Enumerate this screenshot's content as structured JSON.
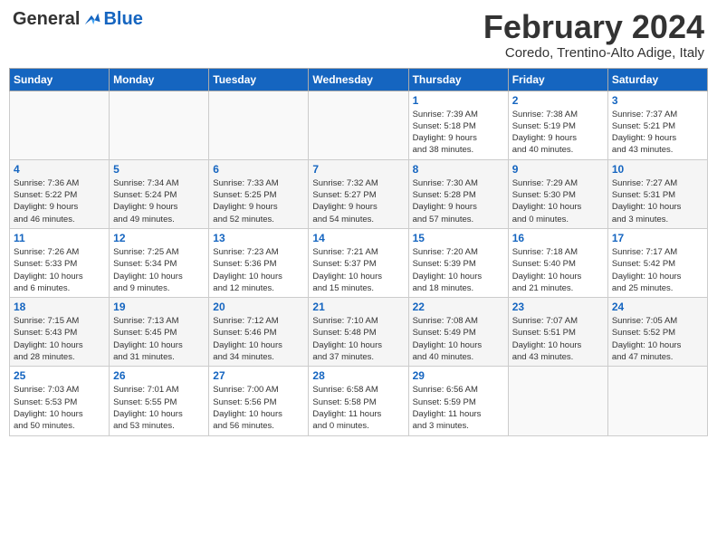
{
  "header": {
    "logo": {
      "general": "General",
      "blue": "Blue"
    },
    "title": "February 2024",
    "location": "Coredo, Trentino-Alto Adige, Italy"
  },
  "weekdays": [
    "Sunday",
    "Monday",
    "Tuesday",
    "Wednesday",
    "Thursday",
    "Friday",
    "Saturday"
  ],
  "weeks": [
    [
      {
        "day": "",
        "info": ""
      },
      {
        "day": "",
        "info": ""
      },
      {
        "day": "",
        "info": ""
      },
      {
        "day": "",
        "info": ""
      },
      {
        "day": "1",
        "info": "Sunrise: 7:39 AM\nSunset: 5:18 PM\nDaylight: 9 hours\nand 38 minutes."
      },
      {
        "day": "2",
        "info": "Sunrise: 7:38 AM\nSunset: 5:19 PM\nDaylight: 9 hours\nand 40 minutes."
      },
      {
        "day": "3",
        "info": "Sunrise: 7:37 AM\nSunset: 5:21 PM\nDaylight: 9 hours\nand 43 minutes."
      }
    ],
    [
      {
        "day": "4",
        "info": "Sunrise: 7:36 AM\nSunset: 5:22 PM\nDaylight: 9 hours\nand 46 minutes."
      },
      {
        "day": "5",
        "info": "Sunrise: 7:34 AM\nSunset: 5:24 PM\nDaylight: 9 hours\nand 49 minutes."
      },
      {
        "day": "6",
        "info": "Sunrise: 7:33 AM\nSunset: 5:25 PM\nDaylight: 9 hours\nand 52 minutes."
      },
      {
        "day": "7",
        "info": "Sunrise: 7:32 AM\nSunset: 5:27 PM\nDaylight: 9 hours\nand 54 minutes."
      },
      {
        "day": "8",
        "info": "Sunrise: 7:30 AM\nSunset: 5:28 PM\nDaylight: 9 hours\nand 57 minutes."
      },
      {
        "day": "9",
        "info": "Sunrise: 7:29 AM\nSunset: 5:30 PM\nDaylight: 10 hours\nand 0 minutes."
      },
      {
        "day": "10",
        "info": "Sunrise: 7:27 AM\nSunset: 5:31 PM\nDaylight: 10 hours\nand 3 minutes."
      }
    ],
    [
      {
        "day": "11",
        "info": "Sunrise: 7:26 AM\nSunset: 5:33 PM\nDaylight: 10 hours\nand 6 minutes."
      },
      {
        "day": "12",
        "info": "Sunrise: 7:25 AM\nSunset: 5:34 PM\nDaylight: 10 hours\nand 9 minutes."
      },
      {
        "day": "13",
        "info": "Sunrise: 7:23 AM\nSunset: 5:36 PM\nDaylight: 10 hours\nand 12 minutes."
      },
      {
        "day": "14",
        "info": "Sunrise: 7:21 AM\nSunset: 5:37 PM\nDaylight: 10 hours\nand 15 minutes."
      },
      {
        "day": "15",
        "info": "Sunrise: 7:20 AM\nSunset: 5:39 PM\nDaylight: 10 hours\nand 18 minutes."
      },
      {
        "day": "16",
        "info": "Sunrise: 7:18 AM\nSunset: 5:40 PM\nDaylight: 10 hours\nand 21 minutes."
      },
      {
        "day": "17",
        "info": "Sunrise: 7:17 AM\nSunset: 5:42 PM\nDaylight: 10 hours\nand 25 minutes."
      }
    ],
    [
      {
        "day": "18",
        "info": "Sunrise: 7:15 AM\nSunset: 5:43 PM\nDaylight: 10 hours\nand 28 minutes."
      },
      {
        "day": "19",
        "info": "Sunrise: 7:13 AM\nSunset: 5:45 PM\nDaylight: 10 hours\nand 31 minutes."
      },
      {
        "day": "20",
        "info": "Sunrise: 7:12 AM\nSunset: 5:46 PM\nDaylight: 10 hours\nand 34 minutes."
      },
      {
        "day": "21",
        "info": "Sunrise: 7:10 AM\nSunset: 5:48 PM\nDaylight: 10 hours\nand 37 minutes."
      },
      {
        "day": "22",
        "info": "Sunrise: 7:08 AM\nSunset: 5:49 PM\nDaylight: 10 hours\nand 40 minutes."
      },
      {
        "day": "23",
        "info": "Sunrise: 7:07 AM\nSunset: 5:51 PM\nDaylight: 10 hours\nand 43 minutes."
      },
      {
        "day": "24",
        "info": "Sunrise: 7:05 AM\nSunset: 5:52 PM\nDaylight: 10 hours\nand 47 minutes."
      }
    ],
    [
      {
        "day": "25",
        "info": "Sunrise: 7:03 AM\nSunset: 5:53 PM\nDaylight: 10 hours\nand 50 minutes."
      },
      {
        "day": "26",
        "info": "Sunrise: 7:01 AM\nSunset: 5:55 PM\nDaylight: 10 hours\nand 53 minutes."
      },
      {
        "day": "27",
        "info": "Sunrise: 7:00 AM\nSunset: 5:56 PM\nDaylight: 10 hours\nand 56 minutes."
      },
      {
        "day": "28",
        "info": "Sunrise: 6:58 AM\nSunset: 5:58 PM\nDaylight: 11 hours\nand 0 minutes."
      },
      {
        "day": "29",
        "info": "Sunrise: 6:56 AM\nSunset: 5:59 PM\nDaylight: 11 hours\nand 3 minutes."
      },
      {
        "day": "",
        "info": ""
      },
      {
        "day": "",
        "info": ""
      }
    ]
  ]
}
